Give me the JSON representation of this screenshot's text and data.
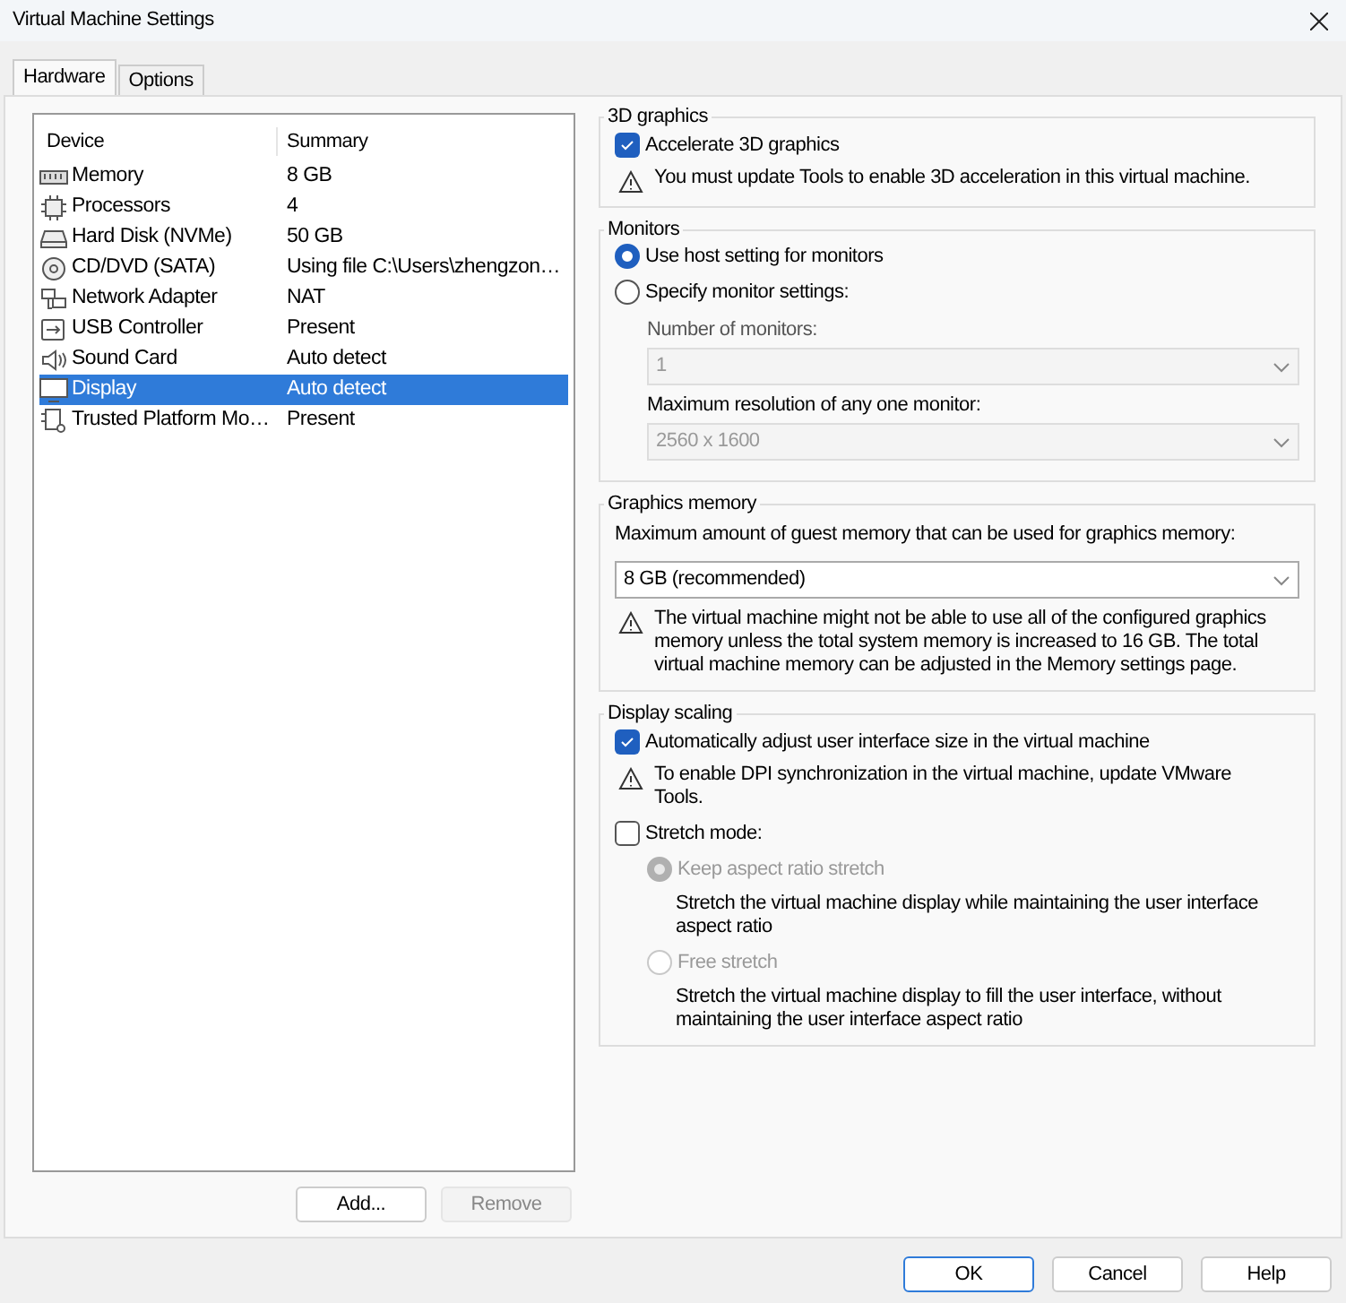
{
  "window": {
    "title": "Virtual Machine Settings"
  },
  "tabs": [
    {
      "label": "Hardware",
      "selected": true
    },
    {
      "label": "Options",
      "selected": false
    }
  ],
  "device_table": {
    "columns": [
      "Device",
      "Summary"
    ],
    "rows": [
      {
        "device": "Memory",
        "summary": "8 GB",
        "selected": false
      },
      {
        "device": "Processors",
        "summary": "4",
        "selected": false
      },
      {
        "device": "Hard Disk (NVMe)",
        "summary": "50 GB",
        "selected": false
      },
      {
        "device": "CD/DVD (SATA)",
        "summary": "Using file C:\\Users\\zhengzon…",
        "selected": false
      },
      {
        "device": "Network Adapter",
        "summary": "NAT",
        "selected": false
      },
      {
        "device": "USB Controller",
        "summary": "Present",
        "selected": false
      },
      {
        "device": "Sound Card",
        "summary": "Auto detect",
        "selected": false
      },
      {
        "device": "Display",
        "summary": "Auto detect",
        "selected": true
      },
      {
        "device": "Trusted Platform Mo…",
        "summary": "Present",
        "selected": false
      }
    ]
  },
  "list_buttons": [
    {
      "label": "Add...",
      "disabled": false
    },
    {
      "label": "Remove",
      "disabled": true
    }
  ],
  "graphics_3d": {
    "title": "3D graphics",
    "accelerate": {
      "label": "Accelerate 3D graphics",
      "checked": true
    },
    "warning": "You must update Tools to enable 3D acceleration in this virtual machine."
  },
  "monitors": {
    "title": "Monitors",
    "options": [
      {
        "label": "Use host setting for monitors",
        "selected": true
      },
      {
        "label": "Specify monitor settings:",
        "selected": false
      }
    ],
    "number_label": "Number of monitors:",
    "number_value": "1",
    "resolution_label": "Maximum resolution of any one monitor:",
    "resolution_value": "2560 x 1600",
    "disabled": true
  },
  "graphics_memory": {
    "title": "Graphics memory",
    "label": "Maximum amount of guest memory that can be used for graphics memory:",
    "value": "8 GB (recommended)",
    "warning": "The virtual machine might not be able to use all of the configured graphics memory unless the total system memory is increased to 16 GB. The total virtual machine memory can be adjusted in the Memory settings page."
  },
  "display_scaling": {
    "title": "Display scaling",
    "auto_adjust": {
      "label": "Automatically adjust user interface size in the virtual machine",
      "checked": true
    },
    "warning": "To enable DPI synchronization in the virtual machine, update VMware Tools.",
    "stretch_mode": {
      "label": "Stretch mode:",
      "checked": false
    },
    "stretch_options": [
      {
        "label": "Keep aspect ratio stretch",
        "selected": true,
        "disabled": true,
        "description": "Stretch the virtual machine display while maintaining the user interface aspect ratio"
      },
      {
        "label": "Free stretch",
        "selected": false,
        "disabled": true,
        "description": "Stretch the virtual machine display to fill the user interface, without maintaining the user interface aspect ratio"
      }
    ]
  },
  "footer_buttons": [
    {
      "label": "OK",
      "default": true
    },
    {
      "label": "Cancel",
      "default": false
    },
    {
      "label": "Help",
      "default": false
    }
  ]
}
